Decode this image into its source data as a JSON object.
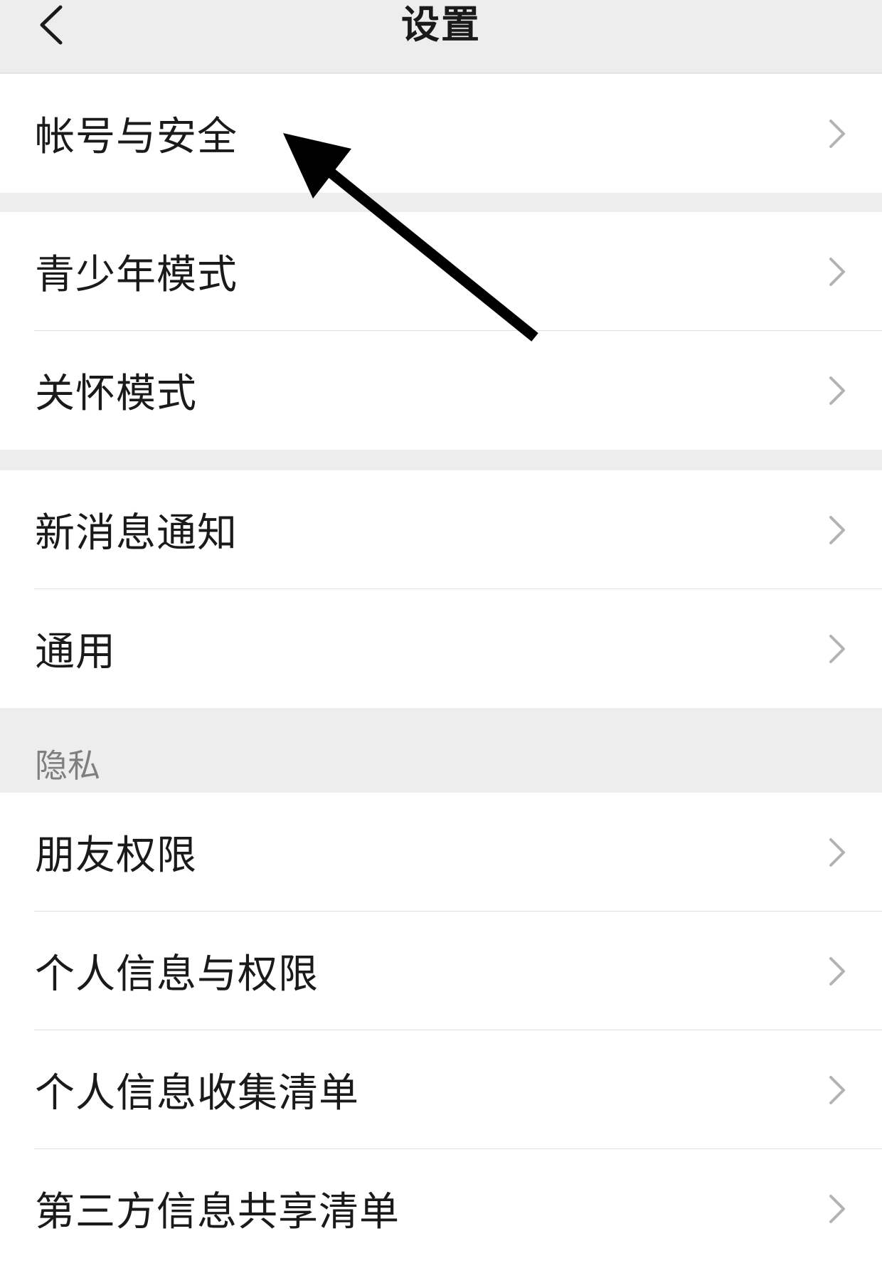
{
  "header": {
    "title": "设置"
  },
  "groups": [
    {
      "items": [
        {
          "label": "帐号与安全"
        }
      ]
    },
    {
      "items": [
        {
          "label": "青少年模式"
        },
        {
          "label": "关怀模式"
        }
      ]
    },
    {
      "items": [
        {
          "label": "新消息通知"
        },
        {
          "label": "通用"
        }
      ]
    },
    {
      "section_title": "隐私",
      "items": [
        {
          "label": "朋友权限"
        },
        {
          "label": "个人信息与权限"
        },
        {
          "label": "个人信息收集清单"
        },
        {
          "label": "第三方信息共享清单"
        }
      ]
    }
  ],
  "icons": {
    "back": "chevron-left-icon",
    "row_arrow": "chevron-right-icon",
    "annotation": "arrow-pointer-icon"
  },
  "colors": {
    "background": "#ededed",
    "row_bg": "#ffffff",
    "text": "#1a1a1a",
    "secondary_text": "#7f7f7f",
    "chevron": "#b3b3b3",
    "annotation_arrow": "#000000"
  }
}
